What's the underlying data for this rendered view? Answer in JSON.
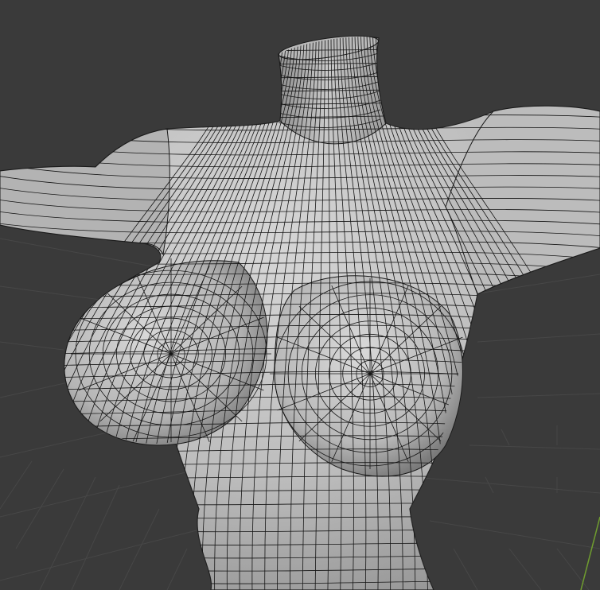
{
  "viewport": {
    "mode": "edit",
    "shading": "solid",
    "wireframe_overlay": true,
    "colors": {
      "background": "#3a3a3a",
      "grid_line": "#4a4a4a",
      "mesh_light": "#d2d2d2",
      "mesh_mid": "#a8a8a8",
      "mesh_dark": "#6e6e6e",
      "edge": "#111111",
      "axis_y": "#6f9c2f"
    },
    "object_icon": "mesh-object-icon"
  }
}
